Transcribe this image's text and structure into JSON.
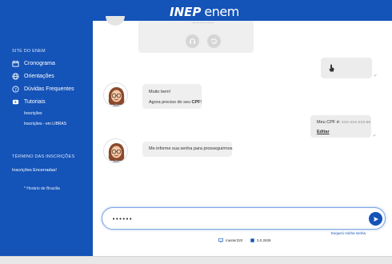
{
  "brand": {
    "inep": "INEP",
    "enem": "enem"
  },
  "sidebar": {
    "section_title": "SITE DO ENEM",
    "items": [
      {
        "label": "Cronograma",
        "icon": "calendar-icon"
      },
      {
        "label": "Orientações",
        "icon": "globe-icon"
      },
      {
        "label": "Dúvidas Frequentes",
        "icon": "question-icon"
      },
      {
        "label": "Tutoriais",
        "icon": "video-icon"
      }
    ],
    "subitems": [
      "Inscrições",
      "Inscrições - em LIBRAS"
    ],
    "deadline_title": "TÉRMINO DAS INSCRIÇÕES",
    "deadline_status": "Inscrições Encerradas!",
    "timezone_note": "* Horário de Brasília"
  },
  "chat": {
    "bot_msg1_line1": "Muito bem!",
    "bot_msg1_line2_prefix": "Agora preciso do seu ",
    "bot_msg1_line2_bold": "CPF",
    "bot_msg1_line2_suffix": "!",
    "user_cpf_prefix": "Meu CPF é: ",
    "user_cpf_value": "XXX.XXX.XXX-69",
    "edit_label": "Editar",
    "bot_msg2": "Me informe sua senha para prosseguirmos"
  },
  "input": {
    "value": "••••••"
  },
  "forgot_password": "Esqueci minha senha",
  "footer": {
    "host": "master320",
    "version": "3.0.2839"
  },
  "colors": {
    "primary": "#1453b8",
    "bubble": "#efefef"
  }
}
